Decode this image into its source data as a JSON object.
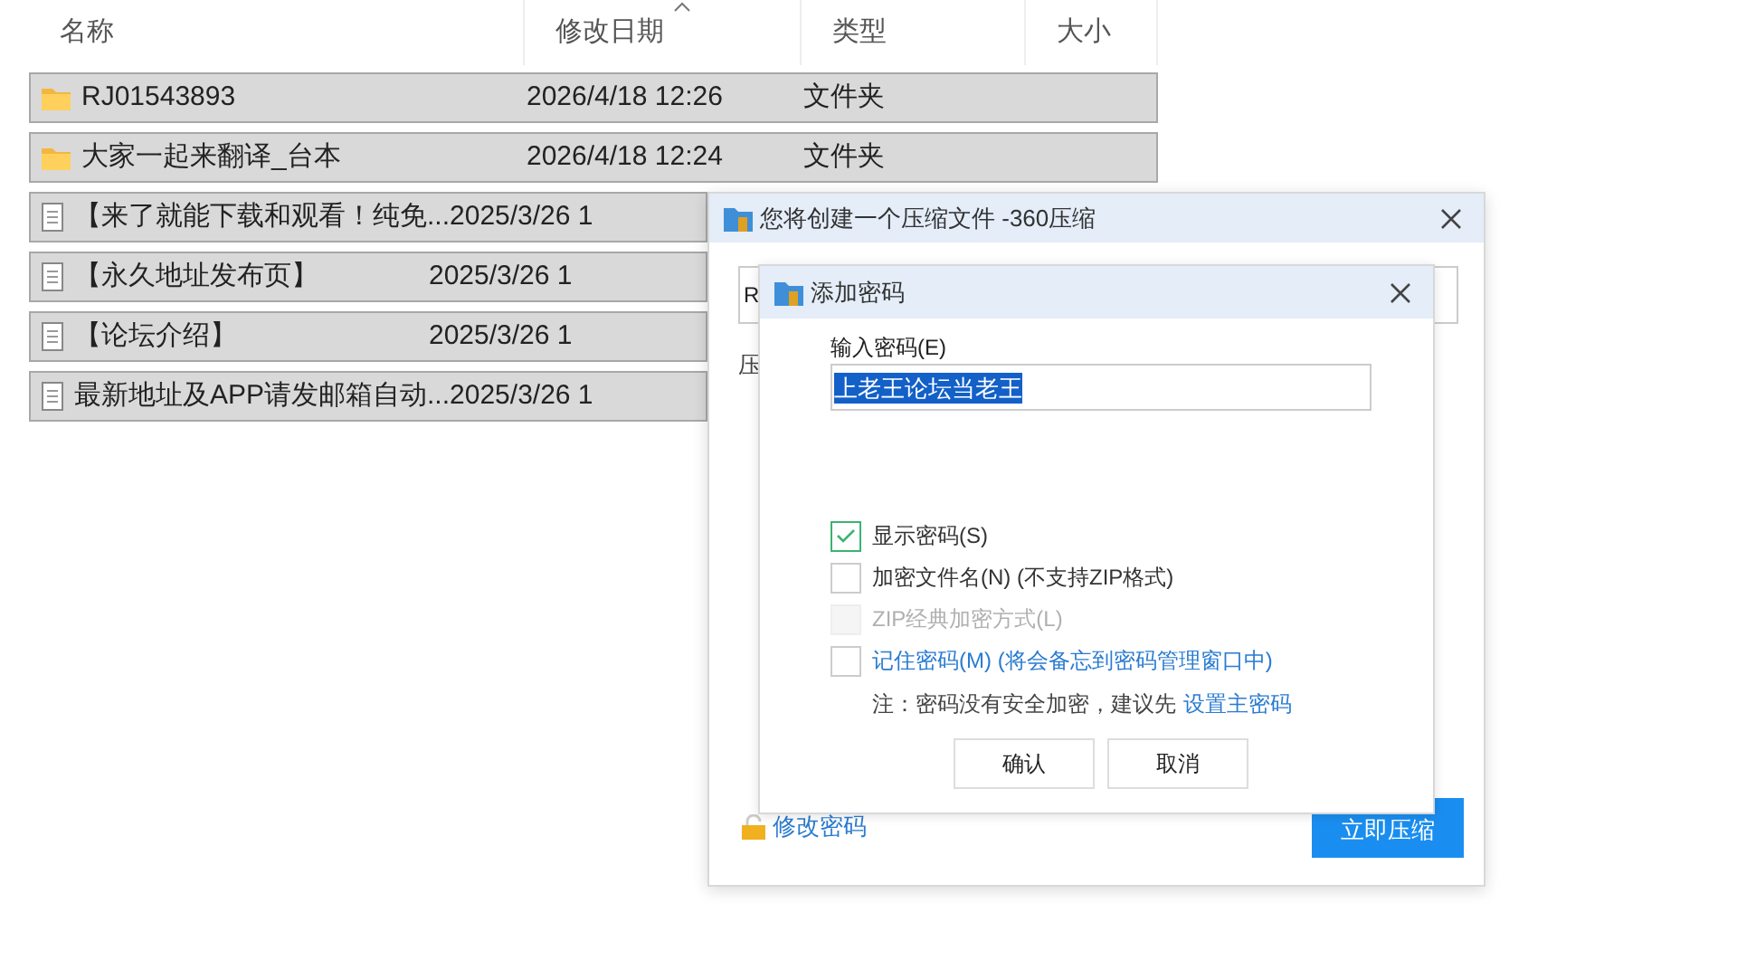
{
  "file_list": {
    "columns": [
      {
        "label": "名称"
      },
      {
        "label": "修改日期"
      },
      {
        "label": "类型"
      },
      {
        "label": "大小"
      }
    ],
    "rows": [
      {
        "kind": "folder",
        "name": "RJ01543893",
        "date": "2026/4/18 12:26",
        "type": "文件夹",
        "selected": true
      },
      {
        "kind": "folder",
        "name": "大家一起来翻译_台本",
        "date": "2026/4/18 12:24",
        "type": "文件夹",
        "selected": true
      },
      {
        "kind": "file",
        "name": "【来了就能下载和观看！纯免...",
        "date": "2025/3/26 1",
        "selected": true
      },
      {
        "kind": "file",
        "name": "【永久地址发布页】",
        "date": "2025/3/26 1",
        "selected": true
      },
      {
        "kind": "file",
        "name": "【论坛介绍】",
        "date": "2025/3/26 1",
        "selected": true
      },
      {
        "kind": "file",
        "name": "最新地址及APP请发邮箱自动...",
        "date": "2025/3/26 1",
        "selected": true
      }
    ]
  },
  "compress_window": {
    "title": "您将创建一个压缩文件 -360压缩",
    "field_value": "R",
    "label": "压",
    "change_password_link": "修改密码",
    "compress_button": "立即压缩"
  },
  "password_dialog": {
    "title": "添加密码",
    "password_label": "输入密码(E)",
    "password_value": "上老王论坛当老王",
    "options": [
      {
        "kind": "plain",
        "label": "显示密码(S)",
        "checked": true,
        "disabled": false
      },
      {
        "kind": "plain",
        "label": "加密文件名(N) (不支持ZIP格式)",
        "checked": false,
        "disabled": false
      },
      {
        "kind": "plain",
        "label": "ZIP经典加密方式(L)",
        "checked": false,
        "disabled": true
      },
      {
        "kind": "link",
        "label": "记住密码(M) (将会备忘到密码管理窗口中)",
        "checked": false,
        "disabled": false
      }
    ],
    "note": "注：密码没有安全加密，建议先",
    "note_link": "设置主密码",
    "buttons": [
      "确认",
      "取消"
    ]
  }
}
